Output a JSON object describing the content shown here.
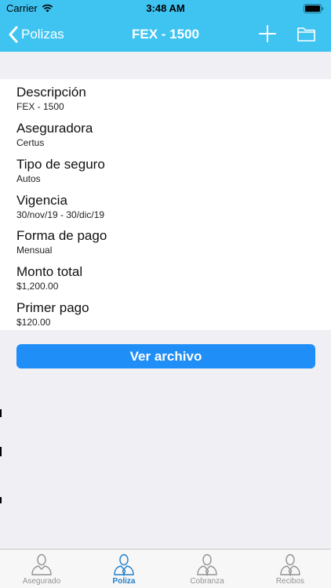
{
  "status_bar": {
    "carrier": "Carrier",
    "time": "3:48 AM"
  },
  "nav": {
    "back_label": "Polizas",
    "title": "FEX - 1500",
    "icons": {
      "back": "chevron-left-icon",
      "add": "plus-icon",
      "folder": "folder-icon"
    }
  },
  "details": [
    {
      "label": "Descripción",
      "value": "FEX - 1500"
    },
    {
      "label": "Aseguradora",
      "value": "Certus"
    },
    {
      "label": "Tipo de seguro",
      "value": "Autos"
    },
    {
      "label": "Vigencia",
      "value": "30/nov/19 - 30/dic/19"
    },
    {
      "label": "Forma de pago",
      "value": "Mensual"
    },
    {
      "label": "Monto total",
      "value": "$1,200.00"
    },
    {
      "label": "Primer pago",
      "value": "$120.00"
    }
  ],
  "action_button": {
    "label": "Ver archivo"
  },
  "tab_bar": {
    "active": "Poliza",
    "tabs": [
      {
        "label": "Asegurado",
        "icon": "person-icon"
      },
      {
        "label": "Poliza",
        "icon": "person-tie-icon"
      },
      {
        "label": "Cobranza",
        "icon": "person-tie-icon"
      },
      {
        "label": "Recibos",
        "icon": "person-tie-icon"
      }
    ]
  },
  "colors": {
    "nav_background": "#3fc4f2",
    "button_background": "#1f8ef7",
    "active_tab": "#1e7ec8",
    "inactive_tab": "#929292",
    "page_background": "#efeff4"
  }
}
